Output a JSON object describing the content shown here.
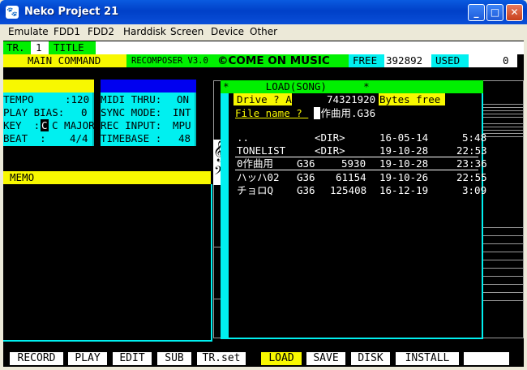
{
  "window": {
    "title": "Neko Project 21",
    "icon": "cat-icon"
  },
  "menu": [
    "Emulate",
    "FDD1",
    "FDD2",
    "Harddisk",
    "Screen",
    "Device",
    "Other"
  ],
  "header": {
    "tr_label": "TR.",
    "tr_num": "1",
    "title_label": "TITLE",
    "main_command": "MAIN COMMAND",
    "recomposer": "RECOMPOSER V3.0",
    "come_on_music": "©COME ON MUSIC",
    "free_label": "FREE",
    "free_value": "392892",
    "used_label": "USED",
    "used_value": "0"
  },
  "settings": {
    "tempo_label": "TEMPO",
    "tempo_value": ":120",
    "playbias_label": "PLAY BIAS:",
    "playbias_value": "0",
    "key_label": "KEY  :",
    "key_value": "C MAJOR",
    "beat_label": "BEAT  :",
    "beat_value": "4/4",
    "midithru_label": "MIDI THRU:",
    "midithru_value": "ON",
    "syncmode_label": "SYNC MODE:",
    "syncmode_value": "INT",
    "recinput_label": "REC INPUT:",
    "recinput_value": "MPU",
    "timebase_label": "TIMEBASE :",
    "timebase_value": "48"
  },
  "memo": {
    "label": "MEMO"
  },
  "load_dialog": {
    "title": "*      LOAD(SONG)      *",
    "drive_label": "Drive ? A",
    "free_bytes": "74321920",
    "bytes_free_label": "Bytes free",
    "filename_label": "File name ? ",
    "filename_value": "0作曲用.G36",
    "files": [
      {
        "name": "..",
        "ext": "",
        "size": "<DIR>",
        "date": "16-05-14",
        "time": "5:48"
      },
      {
        "name": "TONELIST",
        "ext": "",
        "size": "<DIR>",
        "date": "19-10-28",
        "time": "22:53"
      },
      {
        "name": "0作曲用",
        "ext": "G36",
        "size": "5930",
        "date": "19-10-28",
        "time": "23:36"
      },
      {
        "name": "ハッハ02",
        "ext": "G36",
        "size": "61154",
        "date": "19-10-26",
        "time": "22:55"
      },
      {
        "name": "チョロQ",
        "ext": "G36",
        "size": "125408",
        "date": "16-12-19",
        "time": "3:09"
      }
    ]
  },
  "function_keys": [
    "RECORD",
    "PLAY",
    "EDIT",
    "SUB",
    "TR.set",
    "LOAD",
    "SAVE",
    "DISK",
    "INSTALL",
    ""
  ],
  "colors": {
    "cyan": "#00F0F0",
    "yellow": "#F8F800",
    "green": "#00F000",
    "blue": "#0000F0"
  }
}
